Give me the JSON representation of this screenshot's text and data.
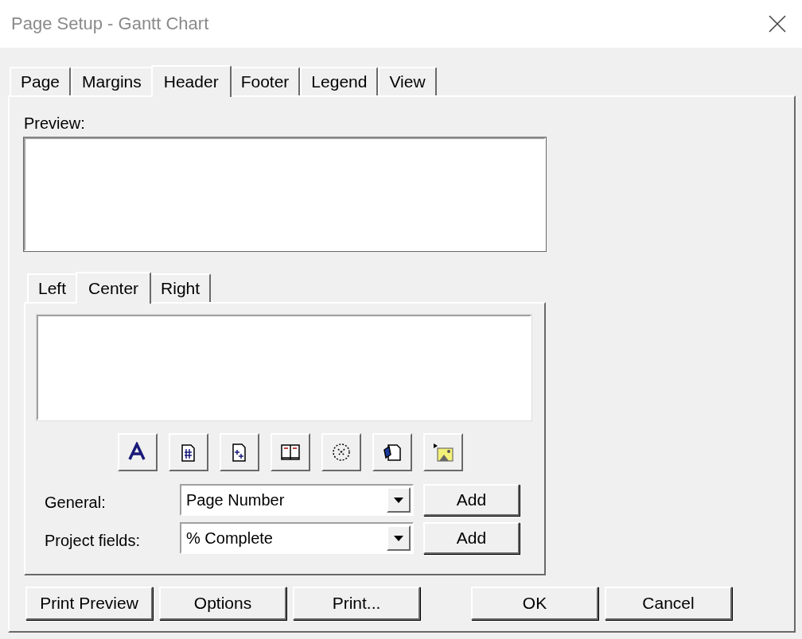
{
  "window": {
    "title": "Page Setup - Gantt Chart"
  },
  "tabs": [
    {
      "label": "Page",
      "selected": false
    },
    {
      "label": "Margins",
      "selected": false
    },
    {
      "label": "Header",
      "selected": true
    },
    {
      "label": "Footer",
      "selected": false
    },
    {
      "label": "Legend",
      "selected": false
    },
    {
      "label": "View",
      "selected": false
    }
  ],
  "preview": {
    "label": "Preview:"
  },
  "section_tabs": [
    {
      "label": "Left",
      "selected": false
    },
    {
      "label": "Center",
      "selected": true
    },
    {
      "label": "Right",
      "selected": false
    }
  ],
  "fields": [
    {
      "label": "General:",
      "value": "Page Number",
      "button": "Add"
    },
    {
      "label": "Project fields:",
      "value": "% Complete",
      "button": "Add"
    }
  ],
  "buttons": [
    "Print Preview",
    "Options",
    "Print...",
    "OK",
    "Cancel"
  ]
}
